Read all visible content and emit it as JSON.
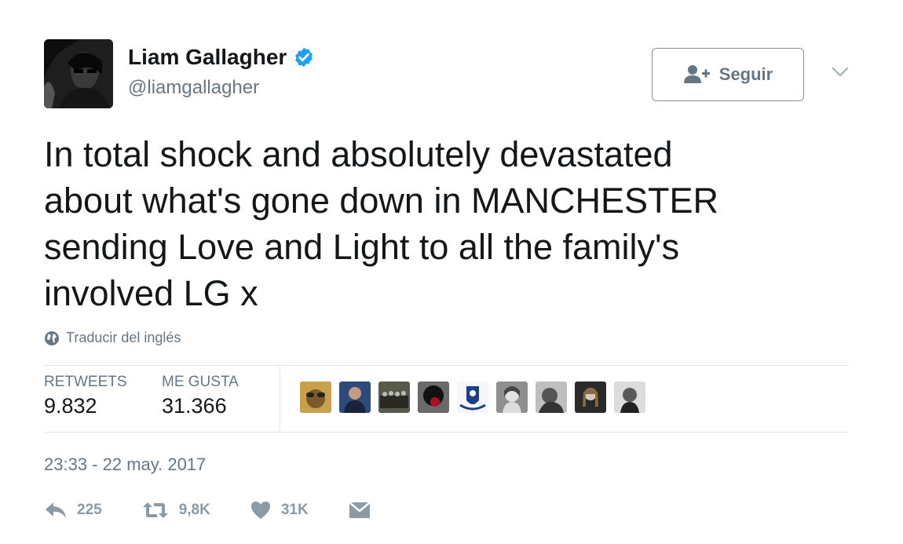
{
  "user": {
    "display_name": "Liam Gallagher",
    "handle": "@liamgallagher",
    "verified": true
  },
  "follow_button": {
    "label": "Seguir"
  },
  "tweet": {
    "lines": [
      "In total shock and absolutely devastated",
      "about what's gone down in MANCHESTER",
      "sending Love and Light to all the family's",
      "involved LG x"
    ]
  },
  "translate": {
    "label": "Traducir del inglés"
  },
  "stats": {
    "retweets_label": "RETWEETS",
    "retweets_value": "9.832",
    "likes_label": "ME GUSTA",
    "likes_value": "31.366"
  },
  "timestamp": "23:33 - 22 may. 2017",
  "actions": {
    "reply_count": "225",
    "retweet_count": "9,8K",
    "like_count": "31K"
  },
  "colors": {
    "text": "#14171a",
    "muted": "#657786",
    "verified": "#1da1f2",
    "divider": "#e1e8ed",
    "action_icon": "#8a9aa6"
  },
  "icons": [
    "verified-badge-icon",
    "follow-person-icon",
    "chevron-down-icon",
    "globe-icon",
    "reply-icon",
    "retweet-icon",
    "heart-icon",
    "direct-message-icon"
  ]
}
